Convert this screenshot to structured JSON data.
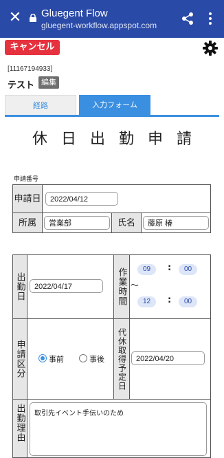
{
  "browser": {
    "title": "Gluegent Flow",
    "url": "gluegent-workflow.appspot.com"
  },
  "toolbar": {
    "cancel_label": "キャンセル"
  },
  "document": {
    "id": "[11167194933]",
    "title": "テスト",
    "edit_badge": "編集"
  },
  "tabs": [
    {
      "label": "経路",
      "active": false
    },
    {
      "label": "入力フォーム",
      "active": true
    }
  ],
  "form": {
    "title": "休日出勤申請",
    "section_label": "申請番号",
    "application_date": {
      "label": "申請日",
      "value": "2022/04/12"
    },
    "department": {
      "label": "所属",
      "value": "営業部"
    },
    "name": {
      "label": "氏名",
      "value": "藤原 椿"
    },
    "work_date": {
      "label": "出勤日",
      "value": "2022/04/17"
    },
    "work_hours": {
      "label": "作業時間",
      "start_hour": "09",
      "start_min": "00",
      "end_hour": "12",
      "end_min": "00",
      "separator": ":",
      "range_symbol": "～"
    },
    "application_type": {
      "label": "申請区分",
      "options": [
        {
          "label": "事前",
          "selected": true
        },
        {
          "label": "事後",
          "selected": false
        }
      ]
    },
    "comp_day": {
      "label": "代休取得予定日",
      "value": "2022/04/20"
    },
    "reason": {
      "label": "出勤理由",
      "value": "取引先イベント手伝いのため"
    }
  },
  "colors": {
    "header_bg": "#2a4aa7",
    "cancel_bg": "#e6323f",
    "accent": "#3a8fe0"
  }
}
